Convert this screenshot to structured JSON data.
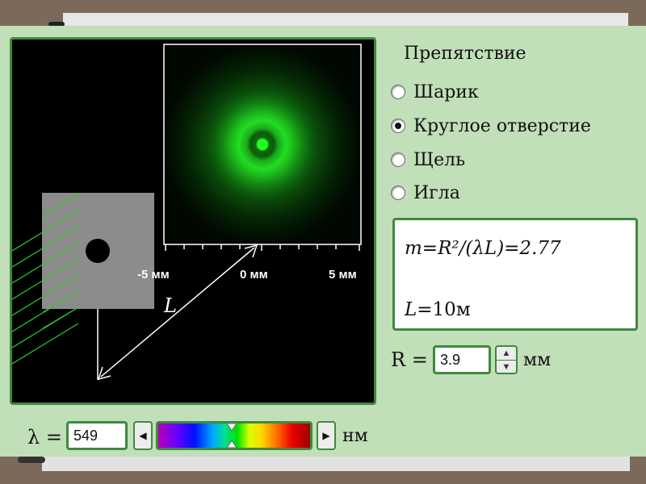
{
  "simulation": {
    "axis_ticks": [
      "-5 мм",
      "0 мм",
      "5 мм"
    ],
    "distance_label": "L"
  },
  "obstacle": {
    "title": "Препятствие",
    "options": [
      {
        "label": "Шарик",
        "selected": false
      },
      {
        "label": "Круглое отверстие",
        "selected": true
      },
      {
        "label": "Щель",
        "selected": false
      },
      {
        "label": "Игла",
        "selected": false
      }
    ]
  },
  "formula": {
    "text": "m=R²/(λL)=2.77",
    "distance_var": "L",
    "distance_value": "=10м"
  },
  "radius": {
    "label": "R =",
    "value": "3.9",
    "unit": "мм"
  },
  "wavelength": {
    "label": "λ =",
    "value": "549",
    "unit": "нм"
  },
  "colors": {
    "panel_bg": "#c1dfb8",
    "border_green": "#3e8a3e",
    "pattern_green": "#22dd22"
  }
}
